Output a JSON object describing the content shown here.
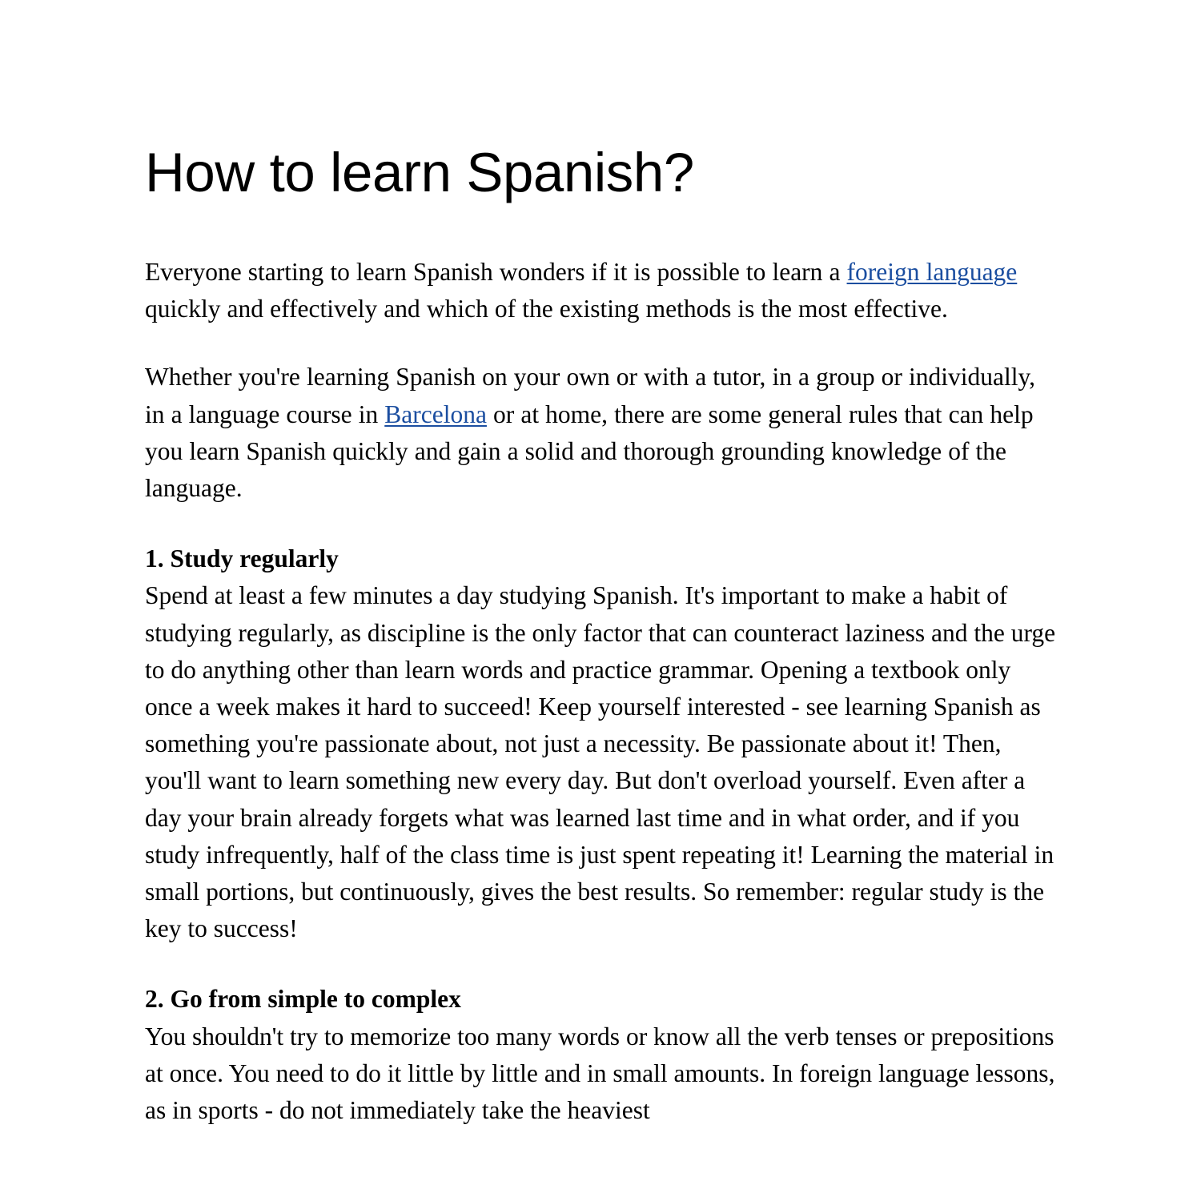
{
  "document": {
    "title": "How to learn Spanish?",
    "link_color": "#1b4ea0",
    "text_color": "#000000",
    "background_color": "#ffffff",
    "paragraphs": {
      "intro_part1": "Everyone starting to learn Spanish wonders if it is possible to learn a ",
      "intro_link1": "foreign language",
      "intro_part2": " quickly and effectively and which of the existing methods is the most effective.",
      "second_part1": "Whether you're learning Spanish on your own or with a tutor, in a group or individually, in a language course in ",
      "second_link1": "Barcelona",
      "second_part2": " or at home, there are some general rules that can help you learn Spanish quickly and gain a solid and thorough grounding knowledge of the language."
    },
    "sections": [
      {
        "heading": "1. Study regularly",
        "body": "Spend at least a few minutes a day studying Spanish. It's important to make a habit of studying regularly, as discipline is the only factor that can counteract laziness and the urge to do anything other than learn words and practice grammar. Opening a textbook only once a week makes it hard to succeed! Keep yourself interested - see learning Spanish as something you're passionate about, not just a necessity. Be passionate about it! Then, you'll want to learn something new every day. But don't overload yourself. Even after a day your brain already forgets what was learned last time and in what order, and if you study infrequently, half of the class time is just spent repeating it! Learning the material in small portions, but continuously, gives the best results. So remember: regular study is the key to success!"
      },
      {
        "heading": "2. Go from simple to complex",
        "body": "You shouldn't try to memorize too many words or know all the verb tenses or prepositions at once. You need to do it little by little and in small amounts. In foreign language lessons, as in sports - do not immediately take the heaviest"
      }
    ]
  }
}
